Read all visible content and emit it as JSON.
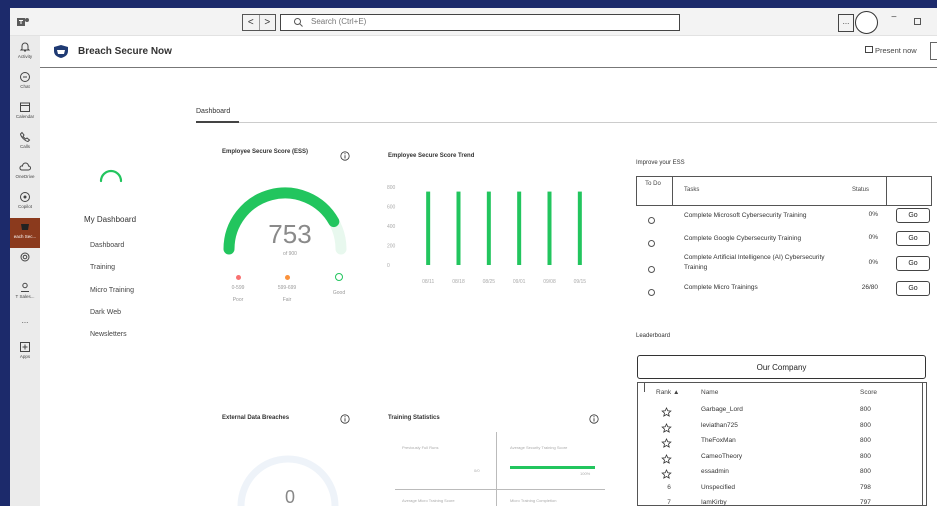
{
  "window": {
    "search_placeholder": "Search (Ctrl+E)",
    "nav_back": "<",
    "nav_forward": ">",
    "more": "...",
    "minimize": "−"
  },
  "rail": {
    "items": [
      {
        "label": "Activity",
        "icon": "bell-icon"
      },
      {
        "label": "Chat",
        "icon": "chat-icon"
      },
      {
        "label": "Calendar",
        "icon": "calendar-icon"
      },
      {
        "label": "Calls",
        "icon": "phone-icon"
      },
      {
        "label": "OneDrive",
        "icon": "cloud-icon"
      },
      {
        "label": "Copilot",
        "icon": "copilot-icon"
      },
      {
        "label": "each Sec...",
        "icon": "breach-app-icon",
        "active": true
      },
      {
        "label": "",
        "icon": "loop-icon"
      },
      {
        "label": "T Sales...",
        "icon": "sales-app-icon"
      },
      {
        "label": "...",
        "icon": "more-apps-icon"
      },
      {
        "label": "Apps",
        "icon": "apps-icon"
      }
    ]
  },
  "header": {
    "app_name": "Breach Secure Now",
    "present": "Present now"
  },
  "menu": {
    "title": "My Dashboard",
    "items": [
      "Dashboard",
      "Training",
      "Micro Training",
      "Dark Web",
      "Newsletters"
    ]
  },
  "tab": "Dashboard",
  "ess_panel": {
    "title": "Employee Secure Score (ESS)",
    "score": "753",
    "max": "of 900",
    "fraction": 0.837,
    "legend": [
      {
        "range": "0-599",
        "name": "Poor",
        "color": "#f87171"
      },
      {
        "range": "599-699",
        "name": "Fair",
        "color": "#fb923c"
      },
      {
        "range": "",
        "name": "Good",
        "color": "#22c55e"
      }
    ],
    "accent": "#22c55e"
  },
  "trend_panel": {
    "title": "Employee Secure Score Trend"
  },
  "chart_data": {
    "type": "bar",
    "title": "Employee Secure Score Trend",
    "categories": [
      "08/11",
      "08/18",
      "08/25",
      "09/01",
      "09/08",
      "09/15"
    ],
    "values": [
      753,
      753,
      753,
      753,
      753,
      753
    ],
    "y_ticks": [
      "0",
      "200",
      "400",
      "600",
      "800"
    ],
    "ylim": [
      0,
      800
    ],
    "color": "#22c55e"
  },
  "improve": {
    "title": "Improve your ESS",
    "col_todo": "To Do",
    "col_tasks": "Tasks",
    "col_status": "Status",
    "rows": [
      {
        "task": "Complete Microsoft Cybersecurity Training",
        "status": "0%",
        "action": "Go"
      },
      {
        "task": "Complete Google Cybersecurity Training",
        "status": "0%",
        "action": "Go"
      },
      {
        "task": "Complete Artificial Intelligence (AI) Cybersecurity Training",
        "status": "0%",
        "action": "Go"
      },
      {
        "task": "Complete Micro Trainings",
        "status": "26/80",
        "action": "Go"
      }
    ]
  },
  "leaderboard": {
    "title": "Leaderboard",
    "company_button": "Our Company",
    "col_rank": "Rank ▲",
    "col_name": "Name",
    "col_score": "Score",
    "rows": [
      {
        "rank": "",
        "name": "Garbage_Lord",
        "score": "800"
      },
      {
        "rank": "",
        "name": "leviathan725",
        "score": "800"
      },
      {
        "rank": "",
        "name": "TheFoxMan",
        "score": "800"
      },
      {
        "rank": "",
        "name": "CameoTheory",
        "score": "800"
      },
      {
        "rank": "",
        "name": "essadmin",
        "score": "800"
      },
      {
        "rank": "6",
        "name": "Unspecified",
        "score": "798"
      },
      {
        "rank": "7",
        "name": "IamKirby",
        "score": "797"
      }
    ]
  },
  "breaches": {
    "title": "External Data Breaches",
    "count": "0"
  },
  "training_stats": {
    "title": "Training Statistics",
    "tl_label": "Previously Full Runs",
    "tl_value": "0/0",
    "tr_label": "Average Security Training Score",
    "tr_value": "100%",
    "tr_fraction": 1.0,
    "bl_label": "Average Micro Training Score",
    "br_label": "Micro Training Completion"
  }
}
